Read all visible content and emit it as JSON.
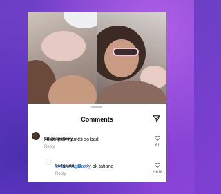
{
  "sheet": {
    "title": "Comments"
  },
  "comments": [
    {
      "username": "tatianagalaxxy",
      "age": "10h",
      "text": "i hate their names so bad",
      "reply_label": "Reply",
      "likes": "81"
    },
    {
      "username": "badgalriri",
      "age": "4h",
      "mention": "@tatianagalaxxy",
      "text": " ok tatiana",
      "reply_label": "Reply",
      "likes": "2,616"
    }
  ],
  "colors": {
    "background": "#7b3fd0",
    "mention": "#2a5db0",
    "verified": "#3897f0"
  },
  "icons": [
    "paper-plane-icon",
    "heart-icon",
    "verified-badge-icon"
  ]
}
